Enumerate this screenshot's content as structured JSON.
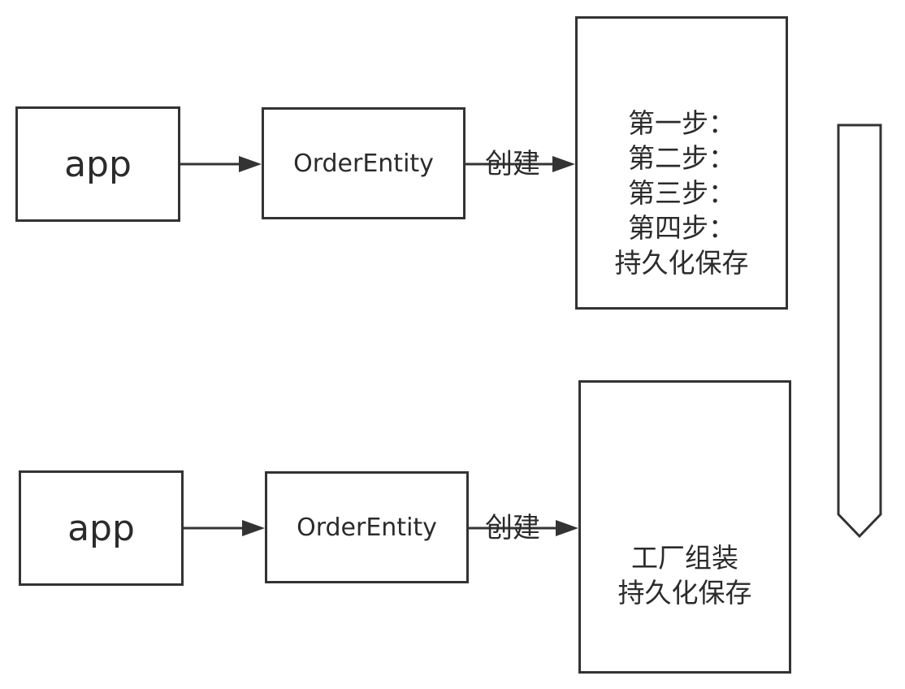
{
  "rows": [
    {
      "app_label": "app",
      "entity_label": "OrderEntity",
      "arrow_label": "创建",
      "process_lines": [
        "第一步：",
        "第二步：",
        "第三步：",
        "第四步：",
        "持久化保存"
      ]
    },
    {
      "app_label": "app",
      "entity_label": "OrderEntity",
      "arrow_label": "创建",
      "process_lines": [
        "工厂组装",
        "持久化保存"
      ]
    }
  ],
  "colors": {
    "stroke": "#333333",
    "text": "#2b2b2b",
    "background": "#ffffff"
  }
}
